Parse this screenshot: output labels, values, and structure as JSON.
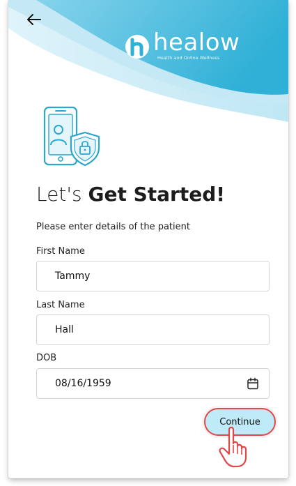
{
  "app": {
    "logo_name": "healow",
    "logo_tagline": "Health and Online Wellness"
  },
  "header": {
    "back_icon": "arrow-left-icon"
  },
  "page": {
    "heading_light": "Let's ",
    "heading_bold": "Get Started!",
    "subtitle": "Please enter details of the patient"
  },
  "form": {
    "first_name": {
      "label": "First Name",
      "value": "Tammy"
    },
    "last_name": {
      "label": "Last Name",
      "value": "Hall"
    },
    "dob": {
      "label": "DOB",
      "value": "08/16/1959",
      "icon": "calendar-icon"
    }
  },
  "actions": {
    "continue_label": "Continue"
  },
  "colors": {
    "brand_teal": "#39b6d9",
    "brand_light": "#a9e0f0",
    "button_bg": "#bfeaf8",
    "highlight_red": "#e04848"
  }
}
